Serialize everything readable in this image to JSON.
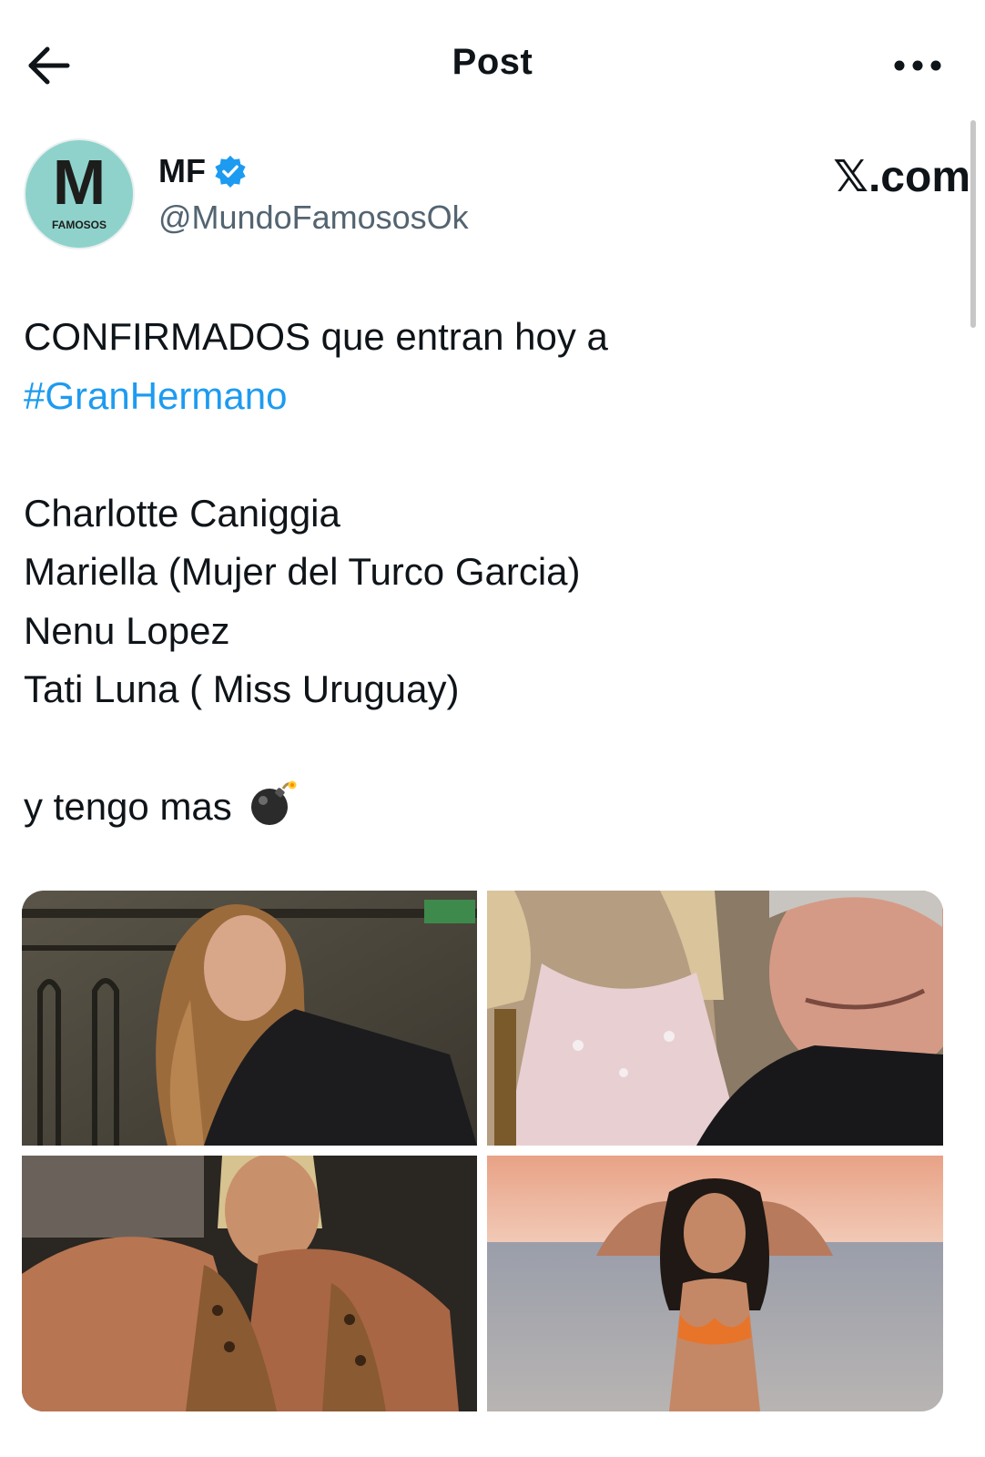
{
  "header": {
    "title": "Post"
  },
  "author": {
    "avatar_letter": "M",
    "avatar_caption": "FAMOSOS",
    "display_name": "MF",
    "handle": "@MundoFamososOk",
    "verified": true
  },
  "watermark": "𝕏.com",
  "post": {
    "line1": "CONFIRMADOS que entran hoy a",
    "hashtag": "#GranHermano",
    "names": [
      "Charlotte Caniggia",
      "Mariella (Mujer del Turco Garcia)",
      "Nenu Lopez",
      "Tati Luna ( Miss Uruguay)"
    ],
    "closing": "y tengo mas",
    "closing_emoji": "bomb-icon"
  },
  "media": {
    "count": 4,
    "photos": [
      {
        "name": "photo-1"
      },
      {
        "name": "photo-2"
      },
      {
        "name": "photo-3"
      },
      {
        "name": "photo-4"
      }
    ]
  },
  "colors": {
    "text": "#0f1419",
    "secondary": "#536471",
    "link": "#1d9bf0",
    "verified": "#1d9bf0",
    "avatar_bg": "#8fd2cc"
  }
}
